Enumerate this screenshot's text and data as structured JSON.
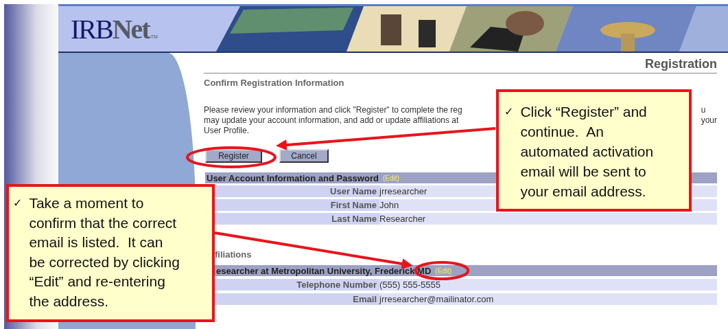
{
  "logo": {
    "text": "IRB",
    "accent": "Net",
    "mark": "TM"
  },
  "header": {
    "kind": "picture"
  },
  "page_title": "Registration",
  "section_title": "Confirm Registration Information",
  "intro_left": [
    "Please review your information and click \"Register\" to complete the reg",
    "may update your account information, and add or update affiliations at",
    "User Profile."
  ],
  "intro_right": [
    "u",
    "your"
  ],
  "buttons": [
    {
      "label": "Register",
      "kind": "submit"
    },
    {
      "label": "Cancel",
      "kind": "cancel"
    }
  ],
  "account": {
    "title": "User Account Information and Password",
    "edit": "(Edit)",
    "rows": [
      {
        "label": "User Name",
        "value": "jrresearcher"
      },
      {
        "label": "First Name",
        "value": "John"
      },
      {
        "label": "Last Name",
        "value": "Researcher"
      }
    ]
  },
  "affiliations": {
    "heading": "filiations",
    "title": "esearcher at Metropolitan University, Frederick MD",
    "edit": "(Edit)",
    "rows": [
      {
        "label": "Telephone Number",
        "value": "(555) 555-5555"
      },
      {
        "label": "Email",
        "value": "jrresearcher@mailinator.com"
      }
    ]
  },
  "callouts": [
    {
      "bullet": "✓",
      "lines": [
        "Click “Register” and",
        "continue.  An",
        "automated activation",
        "email will be sent to",
        "your email address."
      ]
    },
    {
      "bullet": "✓",
      "lines": [
        "Take a moment to",
        "confirm that the correct",
        "email is listed.  It can",
        "be corrected by clicking",
        "“Edit” and re-entering",
        "the address."
      ]
    }
  ]
}
